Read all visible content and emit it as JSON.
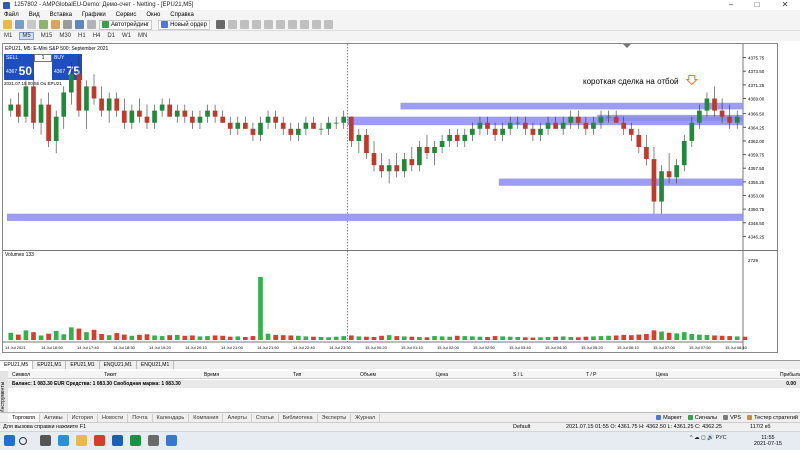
{
  "window": {
    "title": "1257802 - AMPGlobalEU-Demo: Демо-счет - Netting - [EPU21,M5]",
    "controls": [
      "–",
      "□",
      "✕"
    ]
  },
  "menu": [
    "Файл",
    "Вид",
    "Вставка",
    "Графики",
    "Сервис",
    "Окно",
    "Справка"
  ],
  "toolbar": {
    "autotrade_label": "Автотрейдинг",
    "neworder_label": "Новый ордер"
  },
  "timeframes": [
    {
      "label": "M1",
      "active": false
    },
    {
      "label": "M5",
      "active": true
    },
    {
      "label": "M15",
      "active": false
    },
    {
      "label": "M30",
      "active": false
    },
    {
      "label": "H1",
      "active": false
    },
    {
      "label": "H4",
      "active": false
    },
    {
      "label": "D1",
      "active": false
    },
    {
      "label": "W1",
      "active": false
    },
    {
      "label": "MN",
      "active": false
    }
  ],
  "chart": {
    "header": "EPU21, M5:  E-Mini S&P 500: September 2021",
    "subheader": "2021.07.15 00:55 Ou EPU21",
    "sell": {
      "label": "SELL",
      "small": "4367",
      "big": "50"
    },
    "buy": {
      "label": "BUY",
      "small": "4367",
      "big": "75"
    },
    "lot": "1",
    "annotation": "короткая сделка на отбой",
    "volume_label": "Volumes 133",
    "volume_axis_top": "2729",
    "price_ticks": [
      "4375.75",
      "4373.50",
      "4371.25",
      "4369.00",
      "4366.50",
      "4364.25",
      "4362.00",
      "4359.75",
      "4357.50",
      "4355.25",
      "4353.00",
      "4350.75",
      "4348.50",
      "4346.25"
    ],
    "time_ticks": [
      "14 Jul 2021",
      "14 Jul 16:50",
      "14 Jul 17:40",
      "14 Jul 18:30",
      "14 Jul 19:20",
      "14 Jul 20:10",
      "14 Jul 21:00",
      "14 Jul 21:50",
      "14 Jul 22:40",
      "14 Jul 23:30",
      "15 Jul 00:20",
      "15 Jul 01:10",
      "15 Jul 02:00",
      "15 Jul 02:50",
      "15 Jul 03:40",
      "15 Jul 04:30",
      "15 Jul 05:20",
      "15 Jul 06:10",
      "15 Jul 07:00",
      "15 Jul 07:50",
      "15 Jul 08:40"
    ]
  },
  "chart_data": {
    "type": "candlestick",
    "ylim": [
      4345,
      4377
    ],
    "zones": [
      {
        "x0": 52,
        "x1": 104,
        "y0": 4367.2,
        "y1": 4368.3
      },
      {
        "x0": 45,
        "x1": 104,
        "y0": 4364.6,
        "y1": 4366.0
      },
      {
        "x0": 78,
        "x1": 104,
        "y0": 4365.3,
        "y1": 4366.3
      },
      {
        "x0": 65,
        "x1": 104,
        "y0": 4354.6,
        "y1": 4355.8
      },
      {
        "x0": 0,
        "x1": 104,
        "y0": 4348.8,
        "y1": 4350.0
      }
    ],
    "candles": [
      [
        4367,
        4369,
        4366,
        4368
      ],
      [
        4368,
        4370,
        4365,
        4366
      ],
      [
        4366,
        4372,
        4365,
        4371
      ],
      [
        4371,
        4373,
        4364,
        4365
      ],
      [
        4365,
        4369,
        4363,
        4368
      ],
      [
        4368,
        4370,
        4361,
        4362
      ],
      [
        4362,
        4367,
        4360,
        4366
      ],
      [
        4366,
        4371,
        4364,
        4370
      ],
      [
        4370,
        4375,
        4368,
        4373
      ],
      [
        4373,
        4376,
        4366,
        4367
      ],
      [
        4367,
        4372,
        4364,
        4371
      ],
      [
        4371,
        4373,
        4368,
        4369
      ],
      [
        4369,
        4371,
        4366,
        4367
      ],
      [
        4367,
        4370,
        4365,
        4369
      ],
      [
        4369,
        4370,
        4366,
        4367
      ],
      [
        4367,
        4369,
        4364,
        4365
      ],
      [
        4365,
        4368,
        4364,
        4367
      ],
      [
        4367,
        4369,
        4365,
        4366
      ],
      [
        4366,
        4368,
        4364,
        4365
      ],
      [
        4365,
        4368,
        4364,
        4367
      ],
      [
        4367,
        4369,
        4366,
        4368
      ],
      [
        4368,
        4369,
        4366,
        4366
      ],
      [
        4366,
        4368,
        4365,
        4367
      ],
      [
        4367,
        4368,
        4365,
        4366
      ],
      [
        4366,
        4367,
        4364,
        4365
      ],
      [
        4365,
        4367,
        4364,
        4366
      ],
      [
        4366,
        4368,
        4365,
        4367
      ],
      [
        4367,
        4368,
        4365,
        4366
      ],
      [
        4366,
        4367,
        4365,
        4365
      ],
      [
        4365,
        4366,
        4363,
        4364
      ],
      [
        4364,
        4366,
        4363,
        4365
      ],
      [
        4365,
        4366,
        4364,
        4364
      ],
      [
        4364,
        4365,
        4362,
        4363
      ],
      [
        4363,
        4366,
        4362,
        4365
      ],
      [
        4365,
        4367,
        4364,
        4366
      ],
      [
        4366,
        4367,
        4364,
        4365
      ],
      [
        4365,
        4366,
        4363,
        4364
      ],
      [
        4364,
        4365,
        4362,
        4363
      ],
      [
        4363,
        4365,
        4362,
        4364
      ],
      [
        4364,
        4366,
        4363,
        4365
      ],
      [
        4365,
        4366,
        4364,
        4364
      ],
      [
        4364,
        4365,
        4363,
        4364
      ],
      [
        4364,
        4366,
        4363,
        4365
      ],
      [
        4365,
        4366,
        4364,
        4365
      ],
      [
        4365,
        4367,
        4364,
        4366
      ],
      [
        4366,
        4366,
        4361,
        4362
      ],
      [
        4362,
        4364,
        4360,
        4363
      ],
      [
        4363,
        4364,
        4359,
        4360
      ],
      [
        4360,
        4362,
        4357,
        4358
      ],
      [
        4358,
        4360,
        4356,
        4357
      ],
      [
        4357,
        4359,
        4355,
        4358
      ],
      [
        4358,
        4360,
        4356,
        4357
      ],
      [
        4357,
        4360,
        4356,
        4359
      ],
      [
        4359,
        4361,
        4357,
        4358
      ],
      [
        4358,
        4362,
        4357,
        4361
      ],
      [
        4361,
        4363,
        4359,
        4360
      ],
      [
        4360,
        4362,
        4358,
        4361
      ],
      [
        4361,
        4363,
        4360,
        4362
      ],
      [
        4362,
        4364,
        4361,
        4363
      ],
      [
        4363,
        4364,
        4361,
        4362
      ],
      [
        4362,
        4364,
        4361,
        4363
      ],
      [
        4363,
        4365,
        4362,
        4364
      ],
      [
        4364,
        4366,
        4363,
        4365
      ],
      [
        4365,
        4366,
        4363,
        4364
      ],
      [
        4364,
        4365,
        4362,
        4363
      ],
      [
        4363,
        4365,
        4362,
        4364
      ],
      [
        4364,
        4366,
        4363,
        4365
      ],
      [
        4365,
        4366,
        4364,
        4365
      ],
      [
        4365,
        4366,
        4363,
        4364
      ],
      [
        4364,
        4365,
        4362,
        4363
      ],
      [
        4363,
        4365,
        4362,
        4364
      ],
      [
        4364,
        4366,
        4363,
        4365
      ],
      [
        4365,
        4366,
        4364,
        4364
      ],
      [
        4364,
        4366,
        4363,
        4365
      ],
      [
        4365,
        4367,
        4364,
        4366
      ],
      [
        4366,
        4367,
        4364,
        4365
      ],
      [
        4365,
        4366,
        4363,
        4364
      ],
      [
        4364,
        4366,
        4363,
        4365
      ],
      [
        4365,
        4367,
        4364,
        4366
      ],
      [
        4366,
        4367,
        4365,
        4366
      ],
      [
        4366,
        4367,
        4365,
        4365
      ],
      [
        4365,
        4366,
        4363,
        4364
      ],
      [
        4364,
        4365,
        4362,
        4363
      ],
      [
        4363,
        4364,
        4360,
        4361
      ],
      [
        4361,
        4363,
        4358,
        4359
      ],
      [
        4359,
        4361,
        4350,
        4352
      ],
      [
        4352,
        4358,
        4350,
        4357
      ],
      [
        4357,
        4360,
        4355,
        4356
      ],
      [
        4356,
        4359,
        4355,
        4358
      ],
      [
        4358,
        4363,
        4357,
        4362
      ],
      [
        4362,
        4366,
        4361,
        4365
      ],
      [
        4365,
        4368,
        4364,
        4367
      ],
      [
        4367,
        4370,
        4366,
        4369
      ],
      [
        4369,
        4371,
        4366,
        4367
      ],
      [
        4367,
        4369,
        4365,
        4366
      ],
      [
        4366,
        4368,
        4364,
        4365
      ],
      [
        4365,
        4367,
        4364,
        4366
      ]
    ],
    "volumes": [
      240,
      180,
      320,
      260,
      150,
      210,
      300,
      190,
      420,
      380,
      260,
      340,
      200,
      160,
      230,
      180,
      140,
      170,
      190,
      150,
      130,
      160,
      170,
      140,
      150,
      120,
      130,
      150,
      140,
      110,
      120,
      100,
      130,
      520,
      210,
      170,
      160,
      150,
      140,
      120,
      110,
      100,
      90,
      110,
      130,
      150,
      120,
      110,
      100,
      140,
      160,
      130,
      120,
      110,
      100,
      90,
      130,
      120,
      110,
      140,
      130,
      120,
      110,
      100,
      130,
      120,
      110,
      100,
      90,
      80,
      90,
      100,
      110,
      120,
      100,
      90,
      110,
      120,
      130,
      140,
      150,
      170,
      160,
      180,
      200,
      320,
      280,
      240,
      220,
      260,
      200,
      180,
      170,
      150,
      140,
      130,
      120,
      110
    ],
    "vol_max": 2729,
    "volume_spike": {
      "index": 33,
      "value": 2100
    }
  },
  "chart_tabs": [
    "EPU21,M5",
    "EPU21,M1",
    "EPU21,M1",
    "ENQU21,M1",
    "ENQU21,M1"
  ],
  "trade_table": {
    "columns": [
      "Символ",
      "Тикет",
      "Время",
      "Тип",
      "Объем",
      "Цена",
      "S / L",
      "T / P",
      "Цена",
      "Прибыль"
    ],
    "balance": "Баланс: 1 083.30 EUR  Средства: 1 083.30  Свободная маржа: 1 083.30",
    "profit": "0.00",
    "side_label": "Инструменты"
  },
  "toolbox_tabs": [
    "Торговля",
    "Активы",
    "История",
    "Новости",
    "Почта",
    "Календарь",
    "Компания",
    "Алерты",
    "Статьи",
    "Библиотека",
    "Эксперты",
    "Журнал"
  ],
  "toolbox_right": [
    "Маркет",
    "Сигналы",
    "VPS",
    "Тестер стратегий"
  ],
  "status": {
    "help": "Для вызова справки нажмите F1",
    "profile": "Default",
    "ohlc": "2021.07.15 01:55   O: 4361.75   H: 4362.50   L: 4361.25   C: 4362.25",
    "bars": "117/2 кб"
  },
  "taskbar": {
    "tray": "^  ☁  ◻  🔊  РУС",
    "time": "11:55",
    "date": "2021-07-15"
  }
}
